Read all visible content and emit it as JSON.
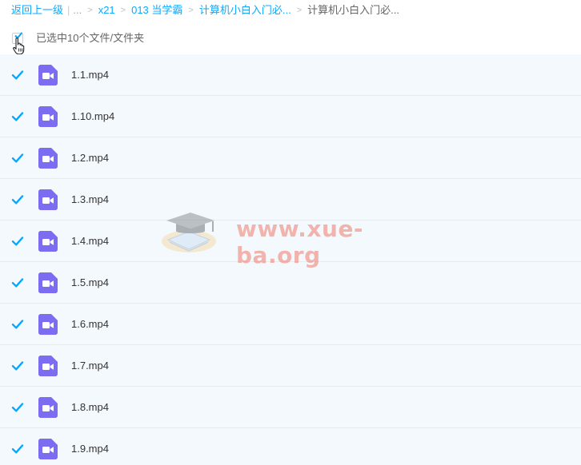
{
  "breadcrumb": {
    "back_label": "返回上一级",
    "ellipsis": "...",
    "items": [
      "x21",
      "013 当学霸",
      "计算机小白入门必..."
    ],
    "current": "计算机小白入门必..."
  },
  "selection": {
    "summary": "已选中10个文件/文件夹"
  },
  "files": [
    {
      "name": "1.1.mp4"
    },
    {
      "name": "1.10.mp4"
    },
    {
      "name": "1.2.mp4"
    },
    {
      "name": "1.3.mp4"
    },
    {
      "name": "1.4.mp4"
    },
    {
      "name": "1.5.mp4"
    },
    {
      "name": "1.6.mp4"
    },
    {
      "name": "1.7.mp4"
    },
    {
      "name": "1.8.mp4"
    },
    {
      "name": "1.9.mp4"
    }
  ],
  "watermark": {
    "text": "www.xue-ba.org"
  },
  "colors": {
    "link": "#09aaff",
    "checkbox": "#06a7ff",
    "video_icon": "#7b6cf2",
    "row_bg": "#f4f9fe"
  },
  "icons": {
    "file_icon": "video-file-icon",
    "check": "checkbox-checked-icon",
    "cursor": "hand-pointer-icon"
  }
}
